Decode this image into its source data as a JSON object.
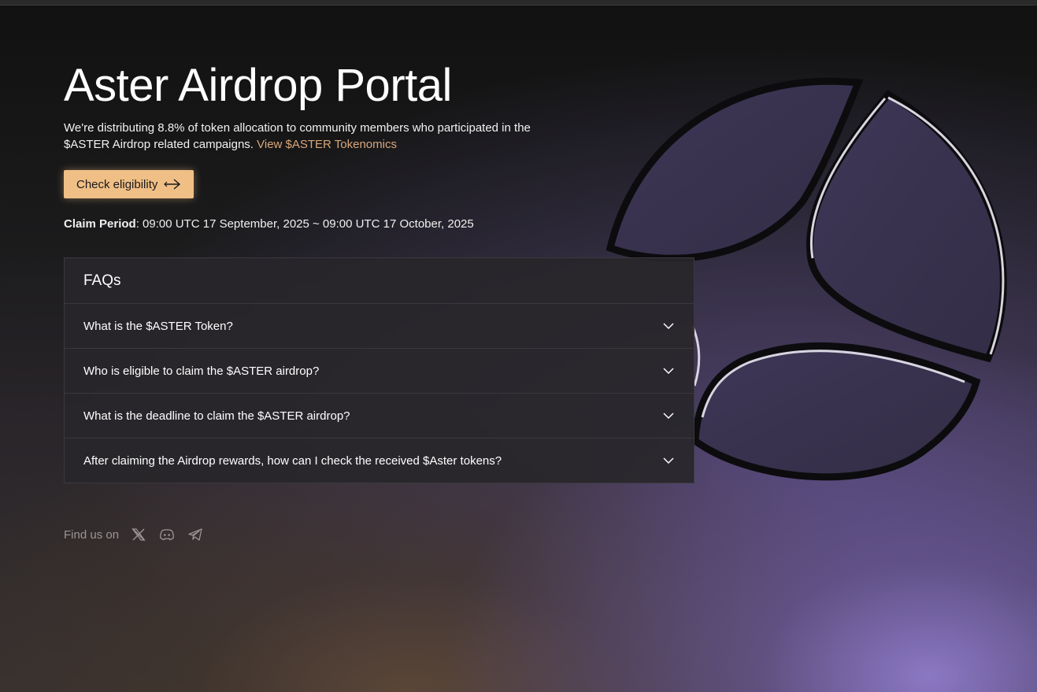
{
  "hero": {
    "title": "Aster Airdrop Portal",
    "description": "We're distributing 8.8% of token allocation to community members who participated in the $ASTER Airdrop related campaigns. ",
    "link_text": "View $ASTER Tokenomics",
    "button_label": "Check eligibility",
    "claim_label": "Claim Period",
    "claim_value": ": 09:00 UTC 17 September, 2025 ~ 09:00 UTC 17 October, 2025"
  },
  "faq": {
    "heading": "FAQs",
    "items": [
      {
        "question": "What is the $ASTER Token?"
      },
      {
        "question": "Who is eligible to claim the $ASTER airdrop?"
      },
      {
        "question": "What is the deadline to claim the $ASTER airdrop?"
      },
      {
        "question": "After claiming the Airdrop rewards, how can I check the received $Aster tokens?"
      }
    ]
  },
  "footer": {
    "find_us_label": "Find us on",
    "social_icons": [
      "x-icon",
      "discord-icon",
      "telegram-icon"
    ]
  },
  "colors": {
    "accent": "#f0bf86",
    "link": "#d9a77a",
    "logo_fill": "#3a3450"
  }
}
